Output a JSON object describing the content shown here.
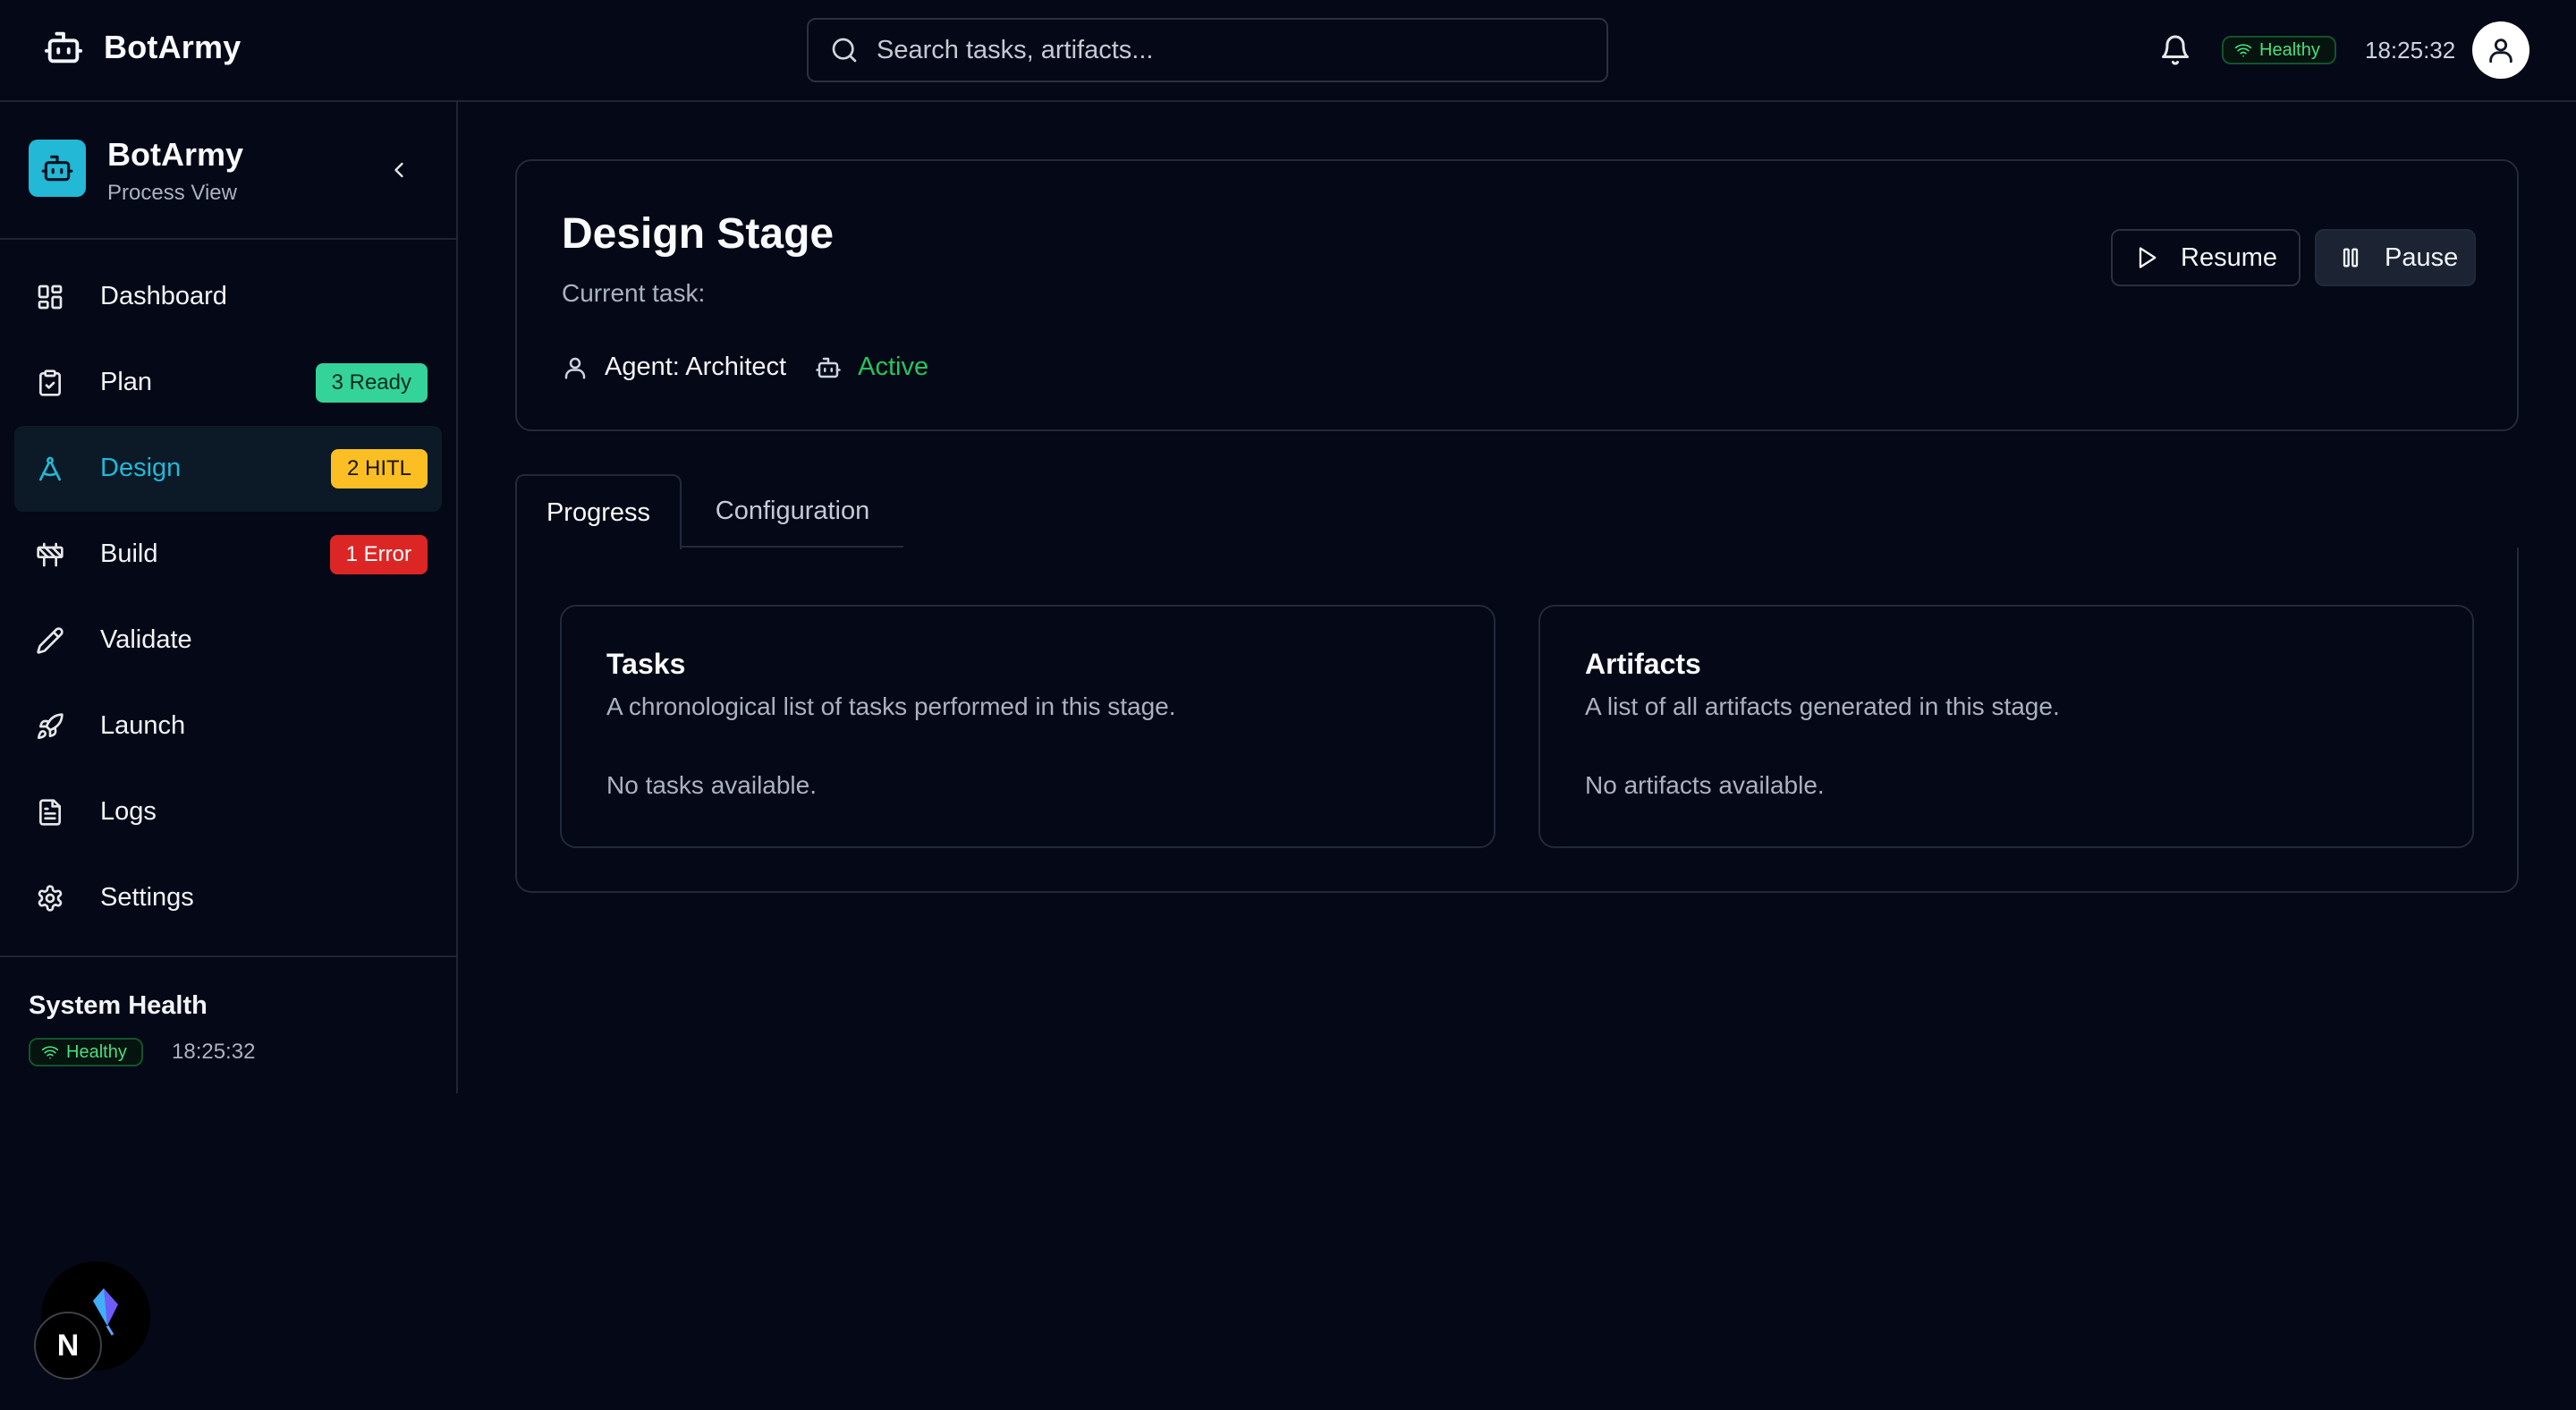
{
  "header": {
    "brand": "BotArmy",
    "search_placeholder": "Search tasks, artifacts...",
    "health": "Healthy",
    "time": "18:25:32"
  },
  "sidebar": {
    "title": "BotArmy",
    "subtitle": "Process View",
    "items": [
      {
        "label": "Dashboard",
        "icon": "dashboard-icon",
        "badge": ""
      },
      {
        "label": "Plan",
        "icon": "clipboard-check-icon",
        "badge": "3 Ready"
      },
      {
        "label": "Design",
        "icon": "compass-icon",
        "badge": "2 HITL"
      },
      {
        "label": "Build",
        "icon": "construction-icon",
        "badge": "1 Error"
      },
      {
        "label": "Validate",
        "icon": "pencil-icon",
        "badge": ""
      },
      {
        "label": "Launch",
        "icon": "rocket-icon",
        "badge": ""
      },
      {
        "label": "Logs",
        "icon": "file-text-icon",
        "badge": ""
      },
      {
        "label": "Settings",
        "icon": "gear-icon",
        "badge": ""
      }
    ],
    "active_item": "Design",
    "footer": {
      "title": "System Health",
      "health": "Healthy",
      "time": "18:25:32"
    }
  },
  "stage": {
    "title": "Design Stage",
    "current_task": "Current task:",
    "agent": "Agent: Architect",
    "status": "Active",
    "resume_label": "Resume",
    "pause_label": "Pause"
  },
  "tabs": [
    {
      "label": "Progress",
      "selected": true
    },
    {
      "label": "Configuration",
      "selected": false
    }
  ],
  "progress": {
    "tasks": {
      "title": "Tasks",
      "description": "A chronological list of tasks performed in this stage.",
      "empty": "No tasks available."
    },
    "artifacts": {
      "title": "Artifacts",
      "description": "A list of all artifacts generated in this stage.",
      "empty": "No artifacts available."
    }
  },
  "dev_overlay": {
    "next_label": "N"
  },
  "colors": {
    "background": "#050816",
    "accent": "#22b8d6",
    "ready": "#34d399",
    "hitl": "#fbbf24",
    "error": "#dc2626",
    "healthy": "#4ade80",
    "active": "#22c55e"
  }
}
